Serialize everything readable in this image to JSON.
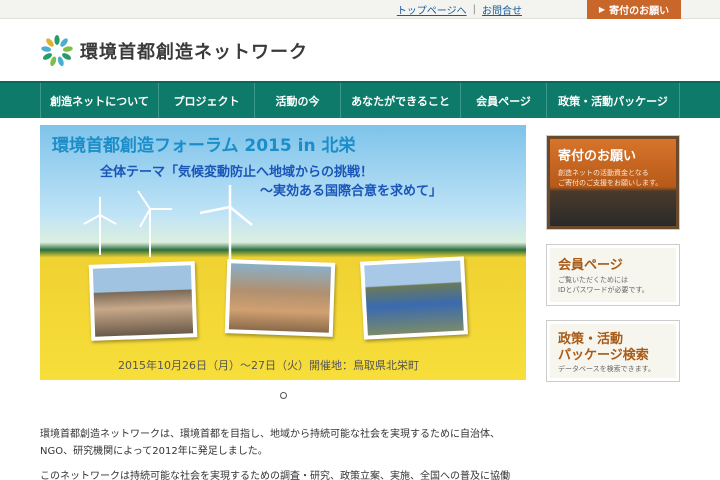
{
  "utility": {
    "top_page": "トップページへ",
    "contact": "お問合せ",
    "donate": "寄付のお願い"
  },
  "header": {
    "site_name": "環境首都創造ネットワーク"
  },
  "nav": {
    "items": [
      {
        "label": "創造ネットについて"
      },
      {
        "label": "プロジェクト"
      },
      {
        "label": "活動の今"
      },
      {
        "label": "あなたができること"
      },
      {
        "label": "会員ページ"
      },
      {
        "label": "政策・活動パッケージ"
      }
    ]
  },
  "banner": {
    "title": "環境首都創造フォーラム 2015 in 北栄",
    "subtitle1": "全体テーマ「気候変動防止へ地域からの挑戦！",
    "subtitle2": "〜実効ある国際合意を求めて」",
    "date": "2015年10月26日（月）〜27日（火）開催地：鳥取県北栄町"
  },
  "sidebar": {
    "donation": {
      "title": "寄付のお願い",
      "line1": "創造ネットの活動資金となる",
      "line2": "ご寄付のご支援をお願いします。"
    },
    "members": {
      "title": "会員ページ",
      "line1": "ご覧いただくためには",
      "line2": "IDとパスワードが必要です。"
    },
    "policy": {
      "title1": "政策・活動",
      "title2": "パッケージ検索",
      "line1": "データベースを検索できます。"
    }
  },
  "intro": {
    "para1_line1": "環境首都創造ネットワークは、環境首都を目指し、地域から持続可能な社会を実現するために自治体、",
    "para1_line2": "NGO、研究機関によって2012年に発足しました。",
    "para2_line1": "このネットワークは持続可能な社会を実現するための調査・研究、政策立案、実施、全国への普及に協働"
  },
  "colors": {
    "nav": "#0e7b6a",
    "accent": "#c9662a",
    "banner_title": "#1b8ec9",
    "banner_sub": "#1a56b8"
  }
}
